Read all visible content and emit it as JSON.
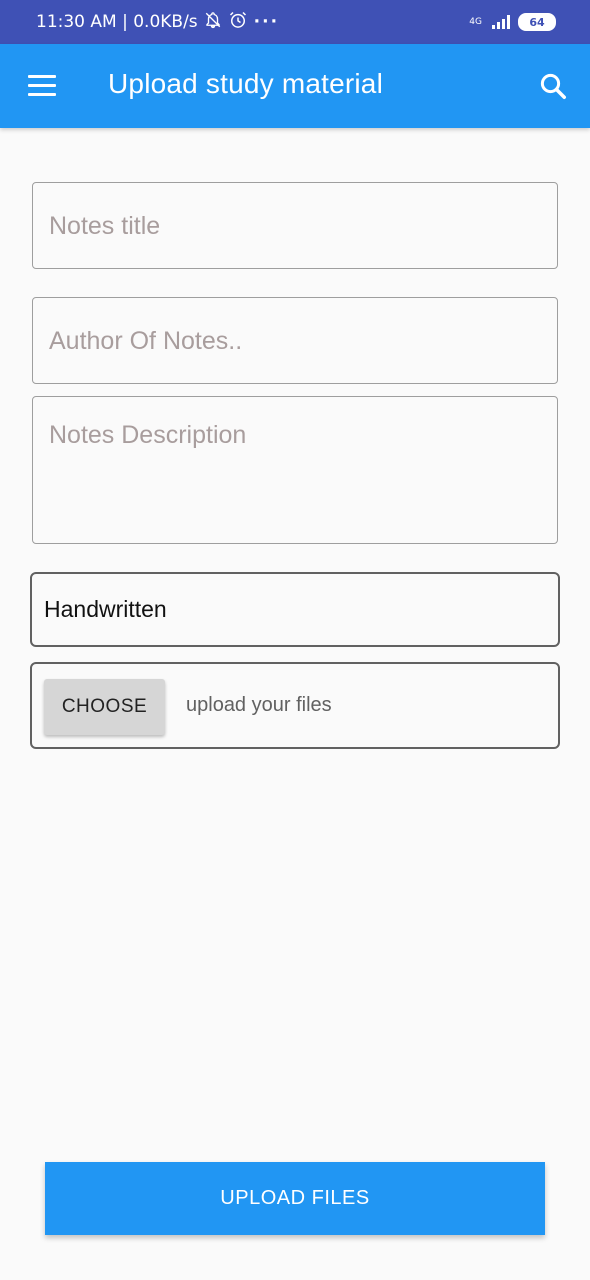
{
  "status_bar": {
    "time_info": "11:30 AM | 0.0KB/s",
    "icons": [
      "notifications-off-icon",
      "alarm-icon",
      "more-icon"
    ],
    "network_label": "4G",
    "battery": "64"
  },
  "app_bar": {
    "title": "Upload study material",
    "menu_icon": "hamburger-menu-icon",
    "search_icon": "search-icon",
    "color": "#2196f3"
  },
  "form": {
    "title_placeholder": "Notes title",
    "author_placeholder": "Author Of Notes..",
    "description_placeholder": "Notes Description",
    "type_selected": "Handwritten",
    "choose_label": "CHOOSE",
    "file_hint": "upload your files"
  },
  "upload_button": {
    "label": "UPLOAD FILES"
  },
  "colors": {
    "status_bar": "#3f51b5",
    "accent": "#2196f3",
    "placeholder": "#a89d9d"
  }
}
